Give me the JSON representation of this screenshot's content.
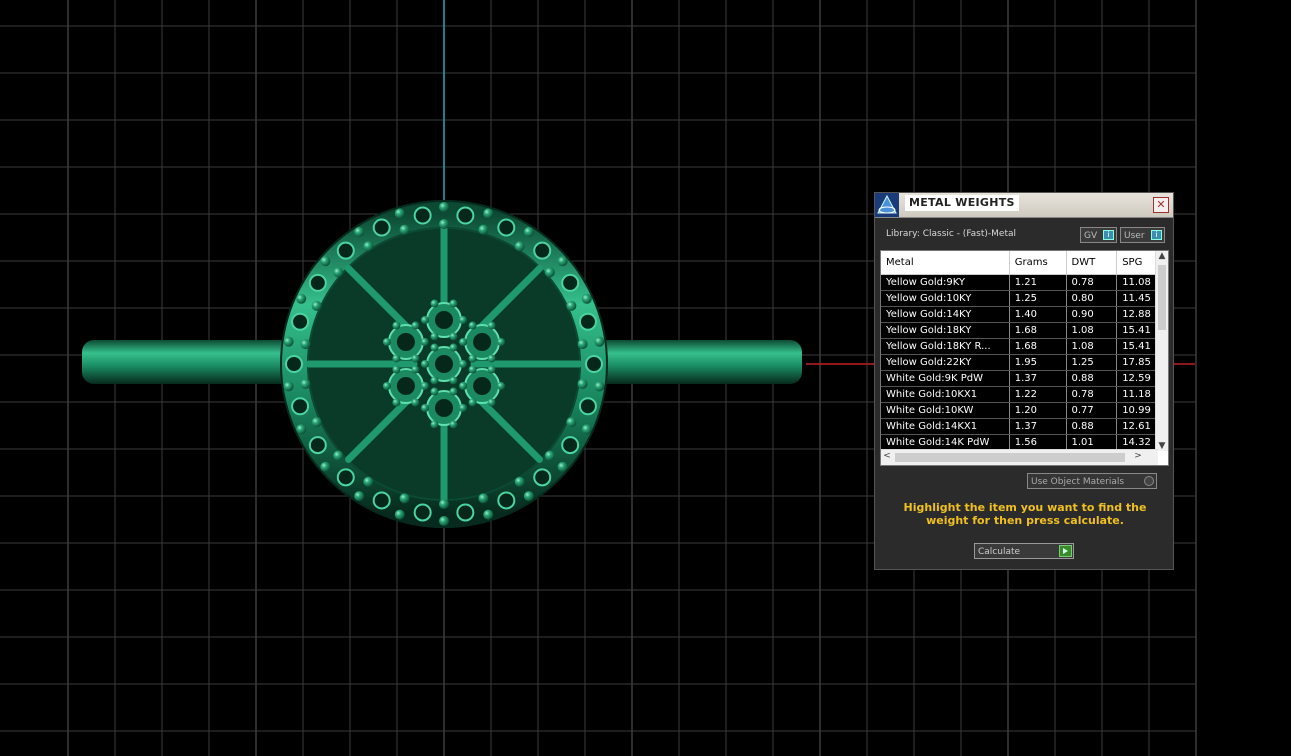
{
  "panel": {
    "title": "METAL WEIGHTS",
    "close_label": "✕",
    "library_label": "Library: Classic - (Fast)-Metal",
    "toggle_gv": "GV",
    "toggle_user": "User",
    "toggle_icon": "i",
    "columns": [
      "Metal",
      "Grams",
      "DWT",
      "SPG"
    ],
    "rows": [
      [
        "Yellow Gold:9KY",
        "1.21",
        "0.78",
        "11.08"
      ],
      [
        "Yellow Gold:10KY",
        "1.25",
        "0.80",
        "11.45"
      ],
      [
        "Yellow Gold:14KY",
        "1.40",
        "0.90",
        "12.88"
      ],
      [
        "Yellow Gold:18KY",
        "1.68",
        "1.08",
        "15.41"
      ],
      [
        "Yellow Gold:18KY R...",
        "1.68",
        "1.08",
        "15.41"
      ],
      [
        "Yellow Gold:22KY",
        "1.95",
        "1.25",
        "17.85"
      ],
      [
        "White Gold:9K PdW",
        "1.37",
        "0.88",
        "12.59"
      ],
      [
        "White Gold:10KX1",
        "1.22",
        "0.78",
        "11.18"
      ],
      [
        "White Gold:10KW",
        "1.20",
        "0.77",
        "10.99"
      ],
      [
        "White Gold:14KX1",
        "1.37",
        "0.88",
        "12.61"
      ],
      [
        "White Gold:14K PdW",
        "1.56",
        "1.01",
        "14.32"
      ]
    ],
    "use_object_materials": "Use Object Materials",
    "hint": "Highlight the item you want to find the weight for then press calculate.",
    "calculate_label": "Calculate"
  },
  "icons": {
    "scroll_up": "▲",
    "scroll_down": "▼",
    "scroll_left": "<",
    "scroll_right": ">"
  }
}
